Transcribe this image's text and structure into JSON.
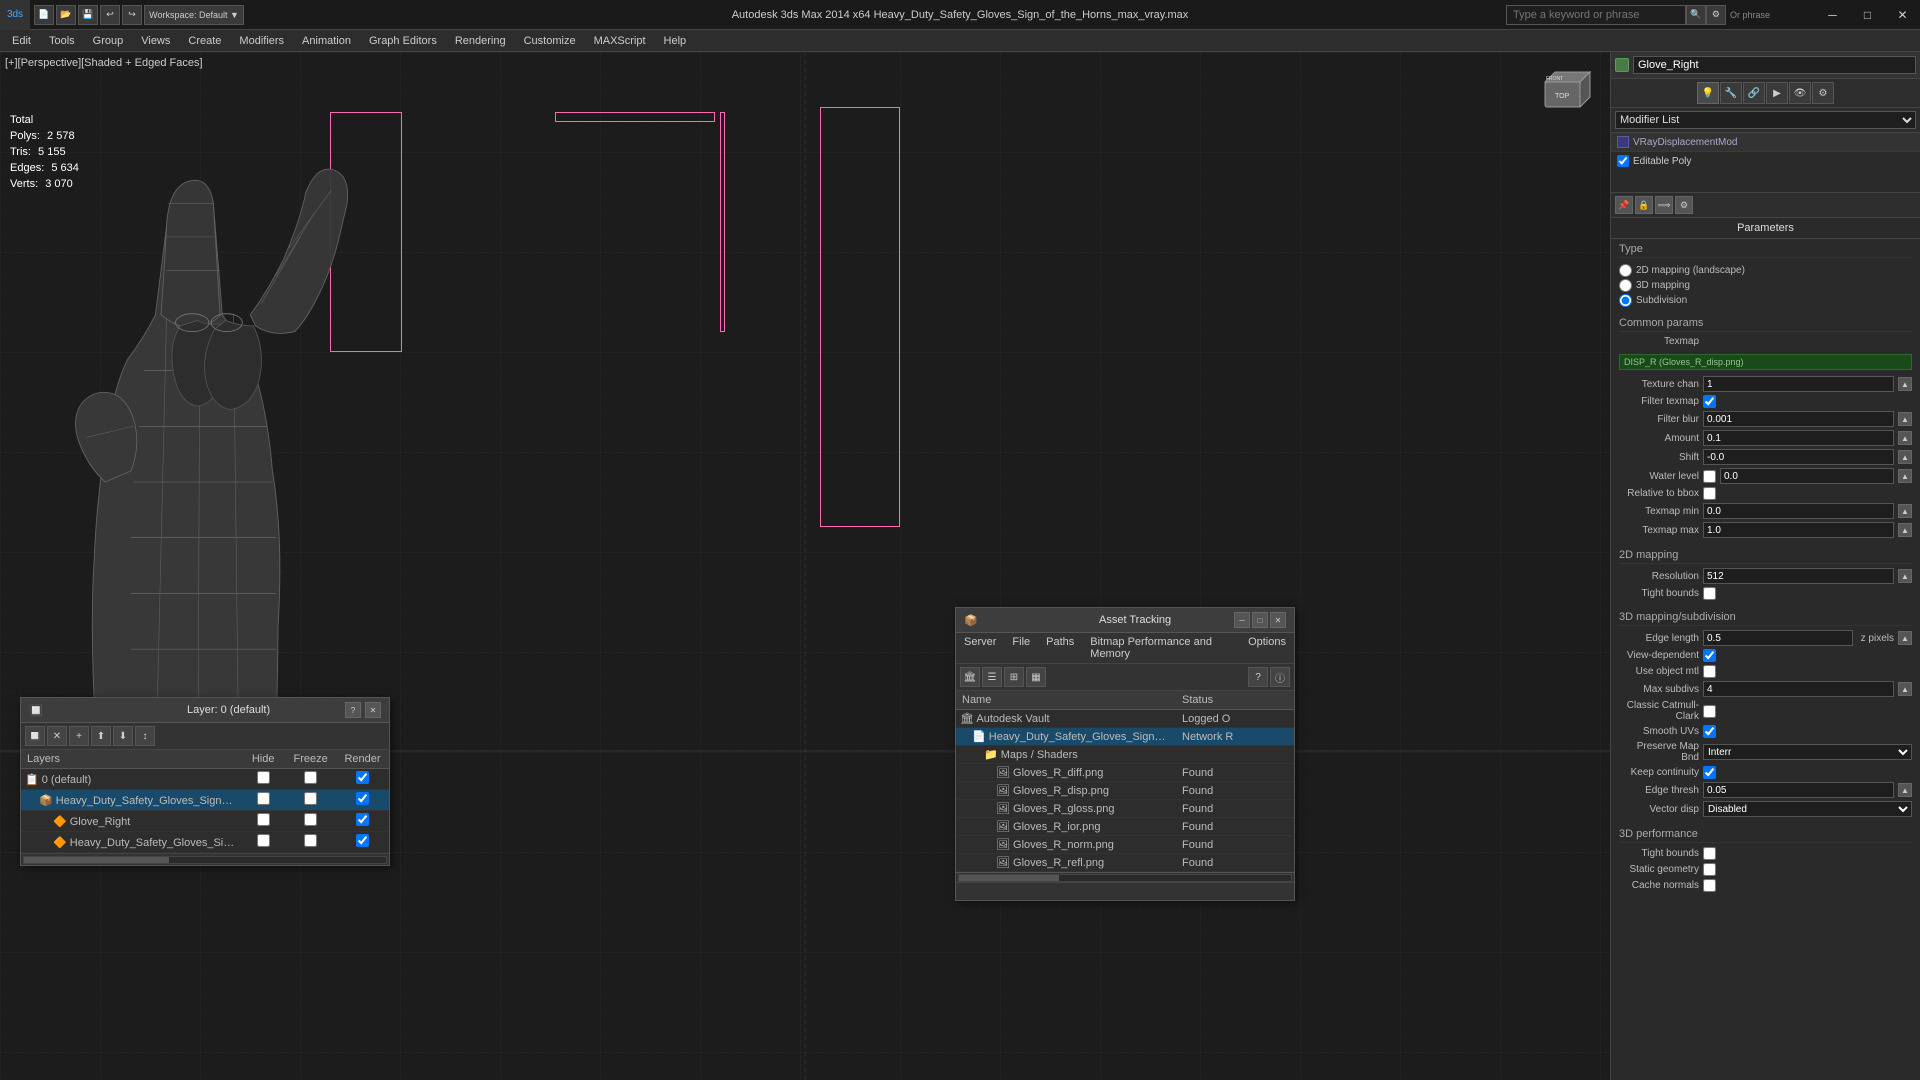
{
  "titlebar": {
    "app_title": "Autodesk 3ds Max 2014 x64      Heavy_Duty_Safety_Gloves_Sign_of_the_Horns_max_vray.max",
    "search_placeholder": "Type a keyword or phrase"
  },
  "menubar": {
    "items": [
      "Edit",
      "Tools",
      "Group",
      "Views",
      "Create",
      "Modifiers",
      "Animation",
      "Graph Editors",
      "Rendering",
      "Customize",
      "MAXScript",
      "Help"
    ]
  },
  "viewport": {
    "label": "[+][Perspective][Shaded + Edged Faces]",
    "stats": {
      "polys_label": "Polys:",
      "polys_val": "2 578",
      "tris_label": "Tris:",
      "tris_val": "5 155",
      "edges_label": "Edges:",
      "edges_val": "5 634",
      "verts_label": "Verts:",
      "verts_val": "3 070",
      "total_label": "Total"
    }
  },
  "right_panel": {
    "object_name": "Glove_Right",
    "modifier_list_label": "Modifier List",
    "modifiers": [
      {
        "name": "VRayDisplacementMod",
        "enabled": true
      },
      {
        "name": "Editable Poly",
        "enabled": true
      }
    ],
    "params_title": "Parameters",
    "type_group": {
      "title": "Type",
      "options": [
        "2D mapping (landscape)",
        "3D mapping",
        "Subdivision"
      ],
      "selected": 2
    },
    "common_params": {
      "title": "Common params",
      "texmap_label": "Texmap",
      "texmap_value": "DISP_R (Gloves_R_disp.png)",
      "texture_chan_label": "Texture chan",
      "texture_chan_value": "1",
      "filter_texmap_label": "Filter texmap",
      "filter_blur_label": "Filter blur",
      "filter_blur_value": "0.001",
      "amount_label": "Amount",
      "amount_value": "0.1",
      "shift_label": "Shift",
      "shift_value": "-0.0",
      "water_level_label": "Water level",
      "water_level_value": "0.0",
      "relative_bbox_label": "Relative to bbox",
      "texmap_min_label": "Texmap min",
      "texmap_min_value": "0.0",
      "texmap_max_label": "Texmap max",
      "texmap_max_value": "1.0"
    },
    "mapping_2d": {
      "title": "2D mapping",
      "resolution_label": "Resolution",
      "resolution_value": "512",
      "tight_bounds_label": "Tight bounds"
    },
    "subdivision": {
      "title": "3D mapping/subdivision",
      "edge_length_label": "Edge length",
      "edge_length_value": "0.5",
      "pixels_label": "z pixels",
      "view_dependent_label": "View-dependent",
      "use_object_mtl_label": "Use object mtl",
      "max_subdivs_label": "Max subdivs",
      "max_subdivs_value": "4",
      "classic_catmull_label": "Classic Catmull-Clark",
      "smooth_uvs_label": "Smooth UVs",
      "preserve_map_bnd_label": "Preserve Map Bnd",
      "preserve_map_bnd_value": "Interr",
      "keep_continuity_label": "Keep continuity",
      "edge_thresh_label": "Edge thresh",
      "edge_thresh_value": "0.05",
      "vector_disp_label": "Vector disp",
      "vector_disp_value": "Disabled"
    },
    "performance": {
      "title": "3D performance",
      "tight_bounds_label": "Tight bounds",
      "static_geometry_label": "Static geometry",
      "cache_normals_label": "Cache normals"
    }
  },
  "asset_tracking": {
    "title": "Asset Tracking",
    "menu": [
      "Server",
      "File",
      "Paths",
      "Bitmap Performance and Memory",
      "Options"
    ],
    "columns": [
      "Name",
      "Status"
    ],
    "rows": [
      {
        "name": "Autodesk Vault",
        "status": "Logged O",
        "indent": 0,
        "type": "vault"
      },
      {
        "name": "Heavy_Duty_Safety_Gloves_Sign_of_the_Horns_max_vray.max",
        "status": "Network R",
        "indent": 1,
        "type": "file"
      },
      {
        "name": "Maps / Shaders",
        "status": "",
        "indent": 2,
        "type": "folder"
      },
      {
        "name": "Gloves_R_diff.png",
        "status": "Found",
        "indent": 3,
        "type": "texture"
      },
      {
        "name": "Gloves_R_disp.png",
        "status": "Found",
        "indent": 3,
        "type": "texture"
      },
      {
        "name": "Gloves_R_gloss.png",
        "status": "Found",
        "indent": 3,
        "type": "texture"
      },
      {
        "name": "Gloves_R_ior.png",
        "status": "Found",
        "indent": 3,
        "type": "texture"
      },
      {
        "name": "Gloves_R_norm.png",
        "status": "Found",
        "indent": 3,
        "type": "texture"
      },
      {
        "name": "Gloves_R_refl.png",
        "status": "Found",
        "indent": 3,
        "type": "texture"
      }
    ]
  },
  "layers": {
    "title": "Layer: 0 (default)",
    "columns": [
      "Layers",
      "Hide",
      "Freeze",
      "Render"
    ],
    "items": [
      {
        "name": "0 (default)",
        "indent": 0,
        "type": "layer",
        "active": false
      },
      {
        "name": "Heavy_Duty_Safety_Gloves_Sign_of_the_Horns",
        "indent": 1,
        "type": "object",
        "active": true
      },
      {
        "name": "Glove_Right",
        "indent": 2,
        "type": "mesh",
        "active": false
      },
      {
        "name": "Heavy_Duty_Safety_Gloves_Sign_of_the_Horns",
        "indent": 2,
        "type": "mesh",
        "active": false
      }
    ]
  }
}
